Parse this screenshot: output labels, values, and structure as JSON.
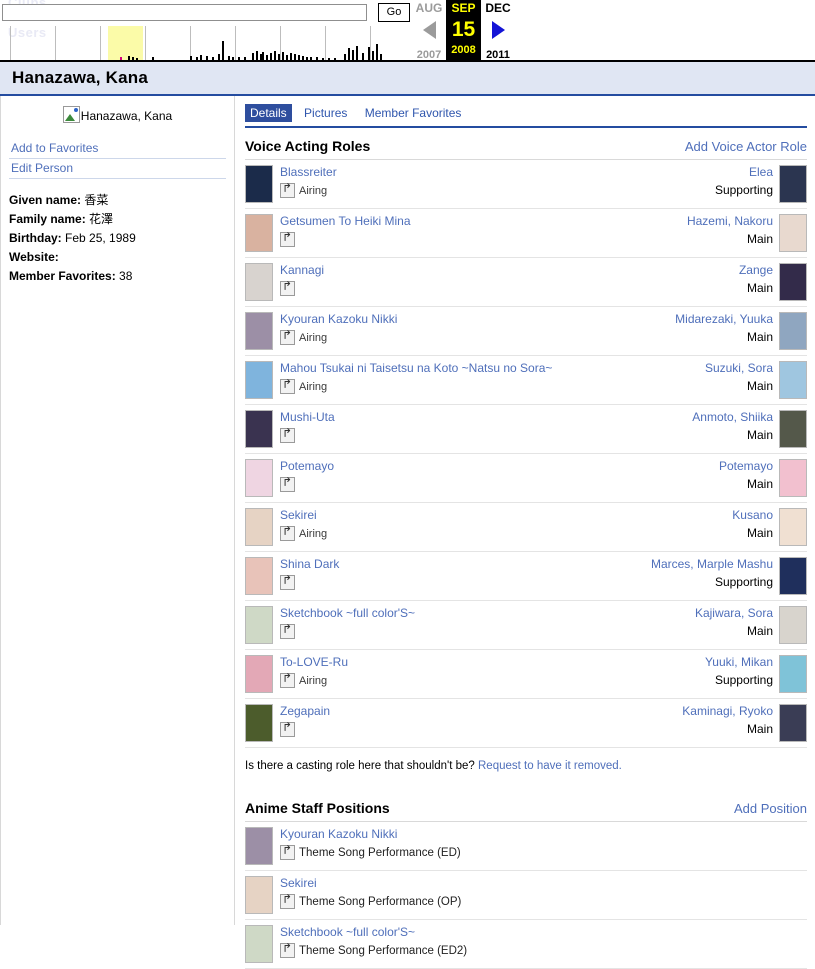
{
  "wayback": {
    "search_value": "",
    "search_placeholder": "",
    "go_label": "Go",
    "prev": {
      "month": "AUG",
      "year": "2007"
    },
    "current": {
      "month": "SEP",
      "day": "15",
      "year": "2008"
    },
    "next": {
      "month": "DEC",
      "year": "2011"
    }
  },
  "ghost_text": {
    "clubs": "Clubs",
    "users": "Users"
  },
  "header": {
    "title": "Hanazawa, Kana"
  },
  "sidebar": {
    "image_alt": "Hanazawa, Kana",
    "links": [
      {
        "label": "Add to Favorites",
        "name": "add-to-favorites-link"
      },
      {
        "label": "Edit Person",
        "name": "edit-person-link"
      }
    ],
    "info": [
      {
        "label": "Given name:",
        "value": "香菜"
      },
      {
        "label": "Family name:",
        "value": "花澤"
      },
      {
        "label": "Birthday:",
        "value": "Feb 25, 1989"
      },
      {
        "label": "Website:",
        "value": ""
      },
      {
        "label": "Member Favorites:",
        "value": "38"
      }
    ]
  },
  "tabs": [
    {
      "label": "Details",
      "active": true
    },
    {
      "label": "Pictures",
      "active": false
    },
    {
      "label": "Member Favorites",
      "active": false
    }
  ],
  "voice_section": {
    "title": "Voice Acting Roles",
    "action_label": "Add Voice Actor Role",
    "rows": [
      {
        "anime": "Blassreiter",
        "status": "Airing",
        "character": "Elea",
        "role": "Supporting",
        "anime_thumb": "#1b2b4a",
        "char_thumb": "#2b3550"
      },
      {
        "anime": "Getsumen To Heiki Mina",
        "status": "",
        "character": "Hazemi, Nakoru",
        "role": "Main",
        "anime_thumb": "#d9b2a0",
        "char_thumb": "#e8d9cf"
      },
      {
        "anime": "Kannagi",
        "status": "",
        "character": "Zange",
        "role": "Main",
        "anime_thumb": "#d8d3cf",
        "char_thumb": "#332b4a"
      },
      {
        "anime": "Kyouran Kazoku Nikki",
        "status": "Airing",
        "character": "Midarezaki, Yuuka",
        "role": "Main",
        "anime_thumb": "#9c8fa6",
        "char_thumb": "#8fa6c0"
      },
      {
        "anime": "Mahou Tsukai ni Taisetsu na Koto ~Natsu no Sora~",
        "status": "Airing",
        "character": "Suzuki, Sora",
        "role": "Main",
        "anime_thumb": "#7fb4dd",
        "char_thumb": "#9fc6e0"
      },
      {
        "anime": "Mushi-Uta",
        "status": "",
        "character": "Anmoto, Shiika",
        "role": "Main",
        "anime_thumb": "#3a3350",
        "char_thumb": "#54584a"
      },
      {
        "anime": "Potemayo",
        "status": "",
        "character": "Potemayo",
        "role": "Main",
        "anime_thumb": "#efd5e2",
        "char_thumb": "#f2c0cf"
      },
      {
        "anime": "Sekirei",
        "status": "Airing",
        "character": "Kusano",
        "role": "Main",
        "anime_thumb": "#e6d3c4",
        "char_thumb": "#f0e0d2"
      },
      {
        "anime": "Shina Dark",
        "status": "",
        "character": "Marces, Marple Mashu",
        "role": "Supporting",
        "anime_thumb": "#e8c3b9",
        "char_thumb": "#1f2f5c"
      },
      {
        "anime": "Sketchbook ~full color'S~",
        "status": "",
        "character": "Kajiwara, Sora",
        "role": "Main",
        "anime_thumb": "#cfd9c6",
        "char_thumb": "#d8d4cd"
      },
      {
        "anime": "To-LOVE-Ru",
        "status": "Airing",
        "character": "Yuuki, Mikan",
        "role": "Supporting",
        "anime_thumb": "#e3a8b6",
        "char_thumb": "#7fc3d8"
      },
      {
        "anime": "Zegapain",
        "status": "",
        "character": "Kaminagi, Ryoko",
        "role": "Main",
        "anime_thumb": "#4c5c2c",
        "char_thumb": "#3a3d55"
      }
    ],
    "footnote_prefix": "Is there a casting role here that shouldn't be?",
    "footnote_link": "Request to have it removed."
  },
  "staff_section": {
    "title": "Anime Staff Positions",
    "action_label": "Add Position",
    "rows": [
      {
        "anime": "Kyouran Kazoku Nikki",
        "position": "Theme Song Performance (ED)",
        "anime_thumb": "#9c8fa6"
      },
      {
        "anime": "Sekirei",
        "position": "Theme Song Performance (OP)",
        "anime_thumb": "#e6d3c4"
      },
      {
        "anime": "Sketchbook ~full color'S~",
        "position": "Theme Song Performance (ED2)",
        "anime_thumb": "#cfd9c6"
      }
    ]
  }
}
